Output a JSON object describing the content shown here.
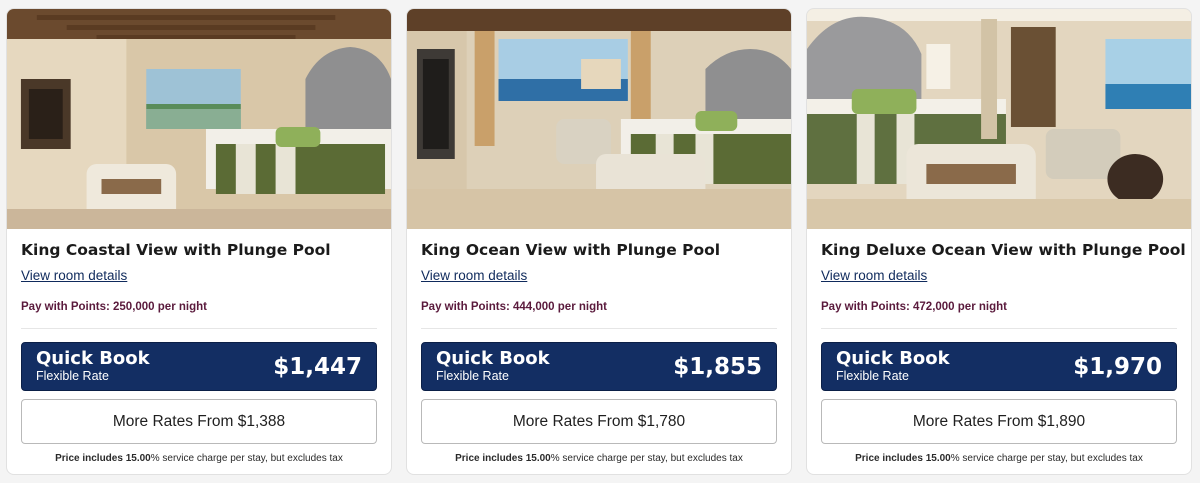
{
  "rooms": [
    {
      "title": "King Coastal View with Plunge Pool",
      "details_link": "View room details",
      "points": "Pay with Points: 250,000 per night",
      "quick_book_label": "Quick Book",
      "quick_book_rate": "Flexible Rate",
      "price": "$1,447",
      "more_rates": "More Rates From $1,388",
      "note_bold": "Price includes 15.00",
      "note_rest": "% service charge per stay, but excludes tax"
    },
    {
      "title": "King Ocean View with Plunge Pool",
      "details_link": "View room details",
      "points": "Pay with Points: 444,000 per night",
      "quick_book_label": "Quick Book",
      "quick_book_rate": "Flexible Rate",
      "price": "$1,855",
      "more_rates": "More Rates From $1,780",
      "note_bold": "Price includes 15.00",
      "note_rest": "% service charge per stay, but excludes tax"
    },
    {
      "title": "King Deluxe Ocean View with Plunge Pool",
      "details_link": "View room details",
      "points": "Pay with Points: 472,000 per night",
      "quick_book_label": "Quick Book",
      "quick_book_rate": "Flexible Rate",
      "price": "$1,970",
      "more_rates": "More Rates From $1,890",
      "note_bold": "Price includes 15.00",
      "note_rest": "% service charge per stay, but excludes tax"
    }
  ],
  "colors": {
    "primary_navy": "#132e63",
    "points_text": "#5a1a3c",
    "link": "#0f2a5c"
  }
}
